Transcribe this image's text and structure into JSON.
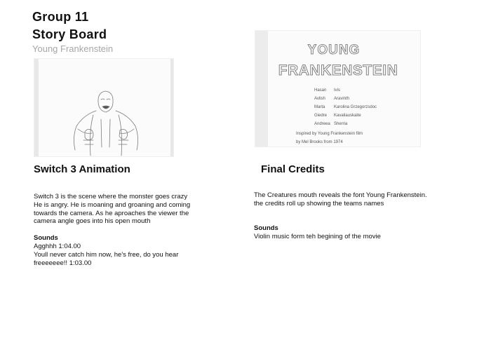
{
  "header": {
    "group": "Group 11",
    "title": "Story Board",
    "subtitle": "Young Frankenstein"
  },
  "scene1": {
    "title": "Switch 3 Animation",
    "description": [
      "Switch 3 is the scene where the monster goes crazy",
      "He is angry. He is moaning and groaning and coming",
      "towards the camera. As he aproaches the viewer the",
      "camera angle goes into his open mouth"
    ],
    "sounds_label": "Sounds",
    "sounds": [
      "Agghhh 1:04.00",
      "Youll never catch him now, he's free, do you hear",
      "freeeeeee!! 1:03.00"
    ]
  },
  "scene2": {
    "title": "Final Credits",
    "description": [
      "The Creatures mouth reveals the font Young Frankenstein.",
      "the credits roll up showing the teams names"
    ],
    "sounds_label": "Sounds",
    "sounds": [
      "Violin music form teh begining of the movie"
    ],
    "sketch": {
      "title_line1": "YOUNG",
      "title_line2": "FRANKENSTEIN",
      "credits": [
        {
          "first": "Hasan",
          "last": "Ivis"
        },
        {
          "first": "Avlish",
          "last": "Aravinth"
        },
        {
          "first": "Marta",
          "last": "Karolina Grzegorzsdoc"
        },
        {
          "first": "Giedre",
          "last": "Kavaliauskaite"
        },
        {
          "first": "Andreea",
          "last": "Sherria"
        }
      ],
      "inspired_line1": "Inspired by Young Frankenstein film",
      "inspired_line2": "by Mel Brooks from 1974"
    }
  }
}
